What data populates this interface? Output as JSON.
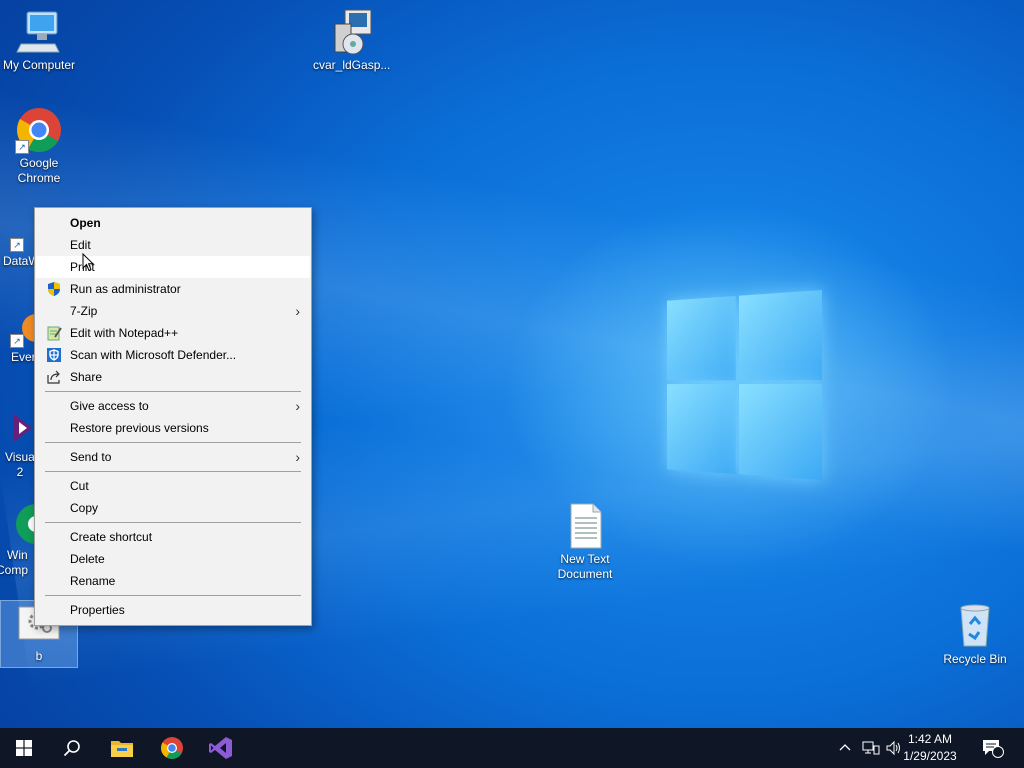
{
  "desktop": {
    "icons": [
      {
        "label": "My Computer"
      },
      {
        "label": "cvar_ldGasp..."
      },
      {
        "label": "Google\nChrome"
      },
      {
        "label": "DataW"
      },
      {
        "label": "Ever"
      },
      {
        "label": "Visua\n2"
      },
      {
        "label": "Win\nComp"
      },
      {
        "label": "b"
      },
      {
        "label": "New Text\nDocument"
      },
      {
        "label": "Recycle Bin"
      }
    ]
  },
  "context_menu": {
    "items": [
      {
        "label": "Open",
        "bold": true
      },
      {
        "label": "Edit"
      },
      {
        "label": "Print",
        "hovered": true
      },
      {
        "label": "Run as administrator",
        "icon": "uac-shield-icon"
      },
      {
        "label": "7-Zip",
        "submenu": true
      },
      {
        "label": "Edit with Notepad++",
        "icon": "notepadpp-icon"
      },
      {
        "label": "Scan with Microsoft Defender...",
        "icon": "defender-icon"
      },
      {
        "label": "Share",
        "icon": "share-icon"
      },
      {
        "label": "Give access to",
        "submenu": true
      },
      {
        "label": "Restore previous versions"
      },
      {
        "label": "Send to",
        "submenu": true
      },
      {
        "label": "Cut"
      },
      {
        "label": "Copy"
      },
      {
        "label": "Create shortcut"
      },
      {
        "label": "Delete"
      },
      {
        "label": "Rename"
      },
      {
        "label": "Properties"
      }
    ]
  },
  "taskbar": {
    "pinned": [
      "start-icon",
      "search-icon",
      "file-explorer-icon",
      "chrome-icon",
      "visual-studio-icon"
    ],
    "clock": {
      "time": "1:42 AM",
      "date": "1/29/2023"
    },
    "notification_count": "1"
  }
}
